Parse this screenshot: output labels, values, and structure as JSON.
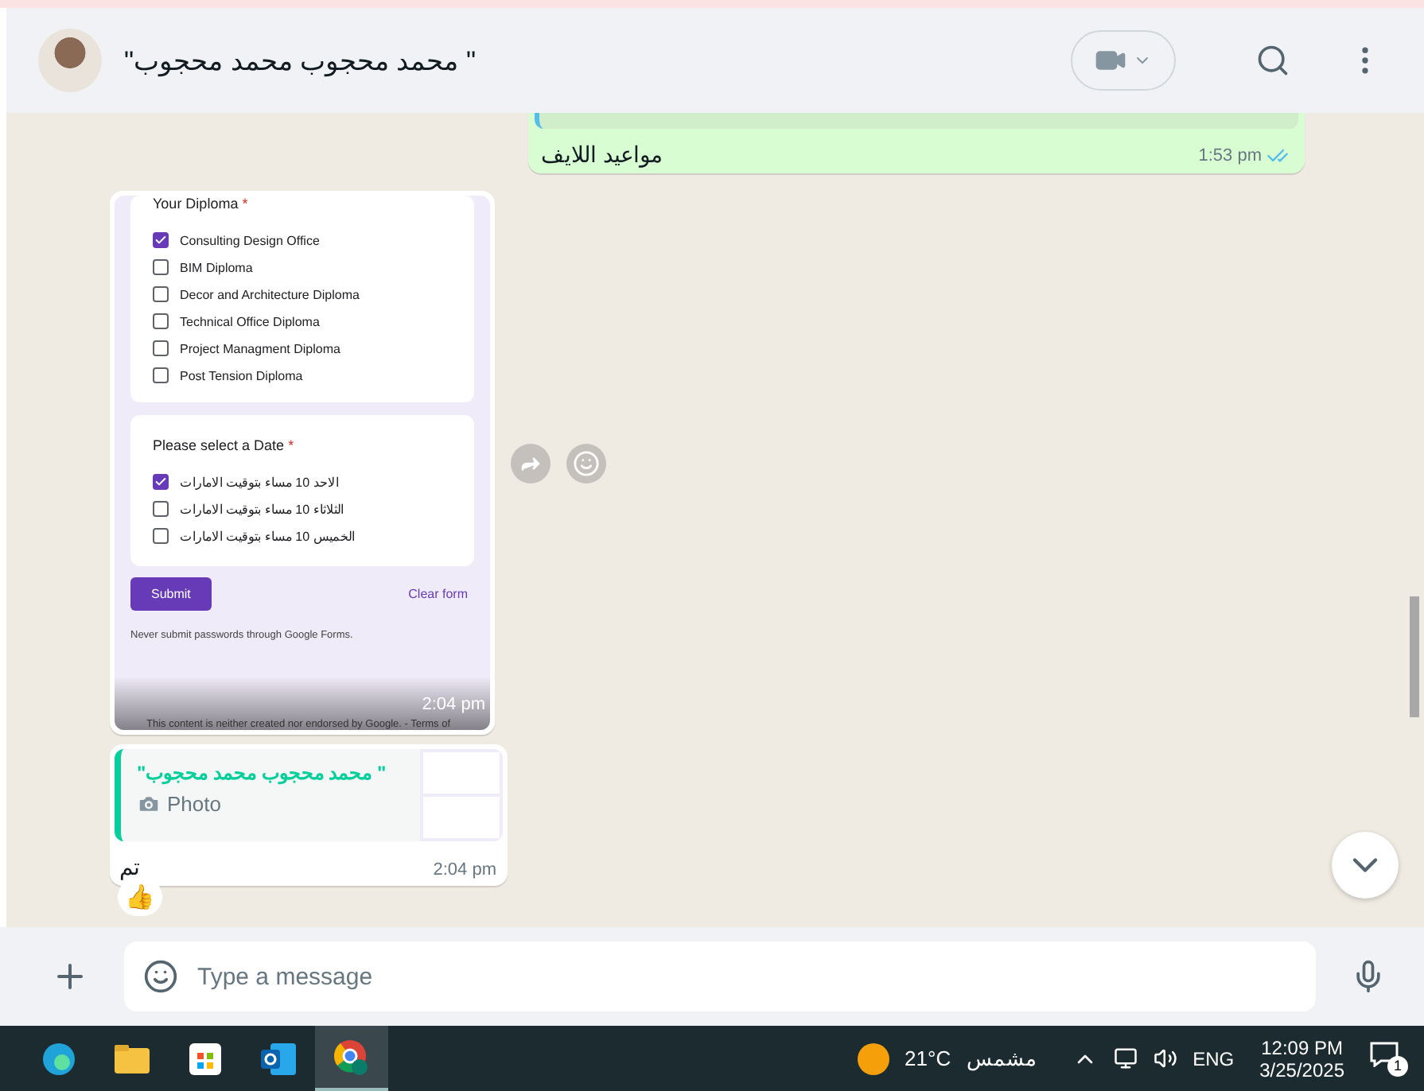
{
  "header": {
    "contact_name": "\"محمد محجوب محمد محجوب \""
  },
  "outgoing_message": {
    "text": "مواعيد اللايف",
    "time": "1:53 pm",
    "read": true
  },
  "form_message": {
    "time": "2:04 pm",
    "diploma_question": {
      "title": "Your Diploma",
      "required_mark": "*",
      "options": [
        {
          "label": "Consulting Design Office",
          "checked": true
        },
        {
          "label": "BIM Diploma",
          "checked": false
        },
        {
          "label": "Decor and Architecture Diploma",
          "checked": false
        },
        {
          "label": "Technical Office Diploma",
          "checked": false
        },
        {
          "label": "Project Managment Diploma",
          "checked": false
        },
        {
          "label": "Post Tension Diploma",
          "checked": false
        }
      ]
    },
    "date_question": {
      "title": "Please select a Date",
      "required_mark": "*",
      "options": [
        {
          "label": "الاحد 10 مساء بتوقيت الامارات",
          "checked": true
        },
        {
          "label": "الثلاثاء 10 مساء بتوقيت الامارات",
          "checked": false
        },
        {
          "label": "الخميس 10 مساء بتوقيت الامارات",
          "checked": false
        }
      ]
    },
    "submit_label": "Submit",
    "clear_label": "Clear form",
    "notice": "Never submit passwords through Google Forms.",
    "disclaimer": "This content is neither created nor endorsed by Google. - Terms of"
  },
  "reply_message": {
    "quoted_author": "\"محمد محجوب محمد محجوب \"",
    "quoted_label": "Photo",
    "text": "تم",
    "time": "2:04 pm",
    "reaction": "👍"
  },
  "composer": {
    "placeholder": "Type a message"
  },
  "taskbar": {
    "temperature": "21°C",
    "weather": "مشمس",
    "language": "ENG",
    "time": "12:09 PM",
    "date": "3/25/2025",
    "notifications": "1"
  }
}
